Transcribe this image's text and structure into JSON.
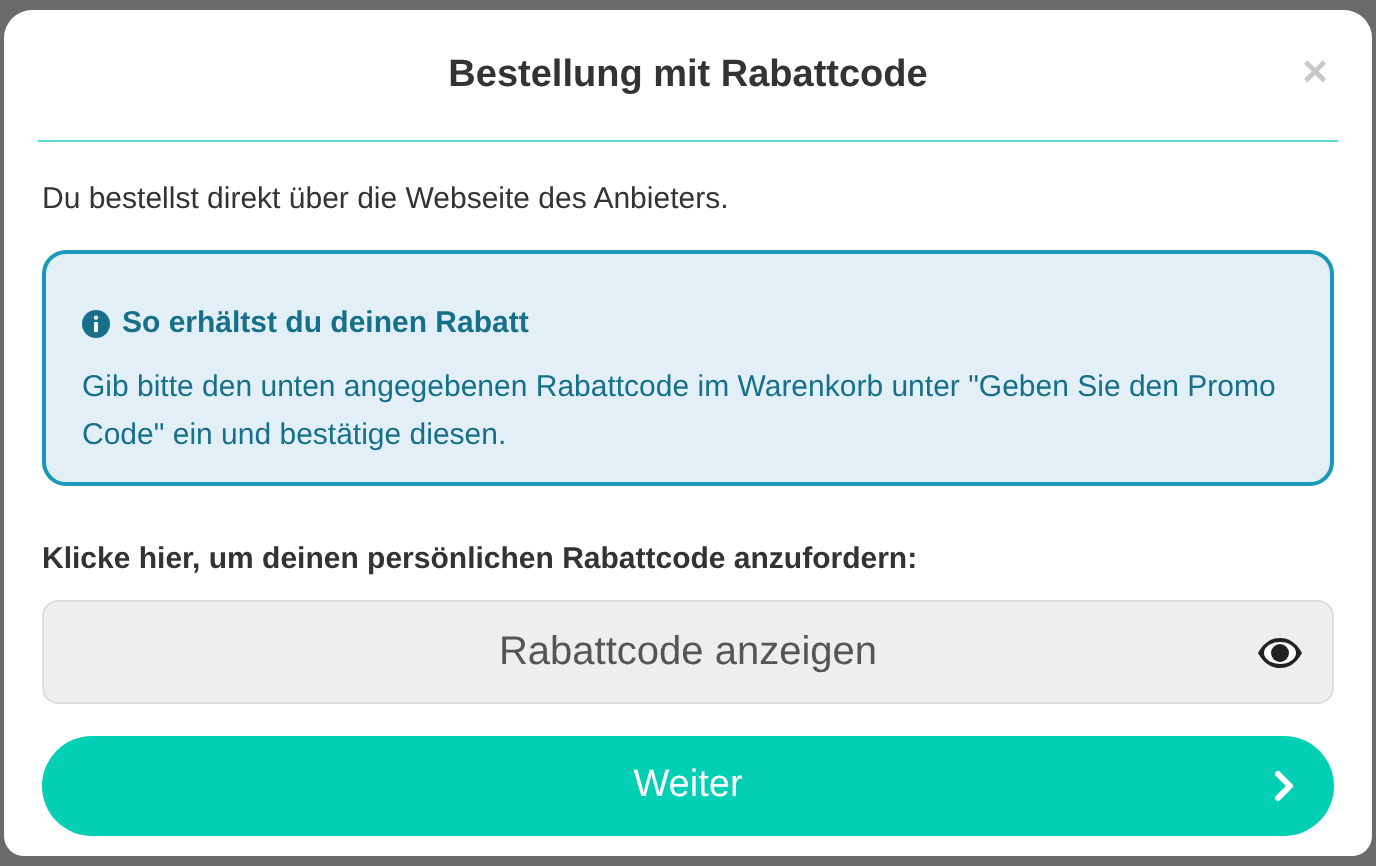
{
  "dialog": {
    "title": "Bestellung mit Rabattcode",
    "close": "×"
  },
  "intro": "Du bestellst direkt über die Webseite des Anbieters.",
  "info": {
    "heading": "So erhältst du deinen Rabatt",
    "text": "Gib bitte den unten angegebenen Rabattcode im Warenkorb unter \"Geben Sie den Promo Code\" ein und bestätige diesen."
  },
  "reveal": {
    "label": "Klicke hier, um deinen persönlichen Rabattcode anzufordern:",
    "button": "Rabattcode anzeigen"
  },
  "continue_button": "Weiter"
}
